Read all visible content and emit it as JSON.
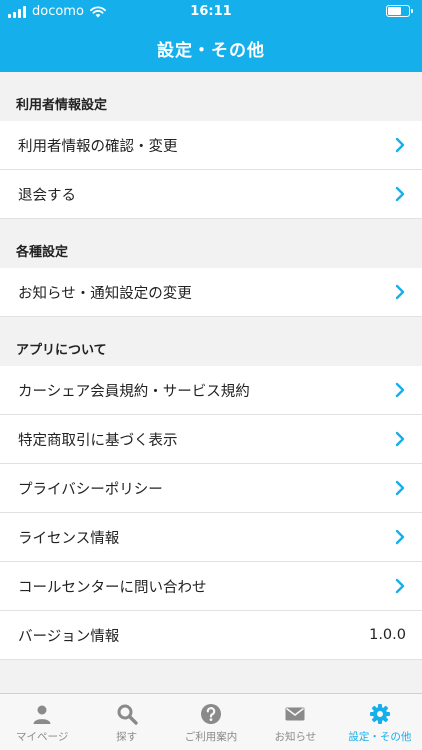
{
  "status_bar": {
    "carrier": "docomo",
    "time": "16:11",
    "battery_level": 0.7
  },
  "header": {
    "title": "設定・その他"
  },
  "sections": [
    {
      "title": "利用者情報設定",
      "rows": [
        {
          "label": "利用者情報の確認・変更"
        },
        {
          "label": "退会する"
        }
      ]
    },
    {
      "title": "各種設定",
      "rows": [
        {
          "label": "お知らせ・通知設定の変更"
        }
      ]
    },
    {
      "title": "アプリについて",
      "rows": [
        {
          "label": "カーシェア会員規約・サービス規約"
        },
        {
          "label": "特定商取引に基づく表示"
        },
        {
          "label": "プライバシーポリシー"
        },
        {
          "label": "ライセンス情報"
        },
        {
          "label": "コールセンターに問い合わせ"
        },
        {
          "label": "バージョン情報",
          "value": "1.0.0"
        }
      ]
    }
  ],
  "tabbar": {
    "tabs": [
      {
        "label": "マイページ",
        "icon": "person-icon"
      },
      {
        "label": "探す",
        "icon": "search-icon"
      },
      {
        "label": "ご利用案内",
        "icon": "question-circle-icon"
      },
      {
        "label": "お知らせ",
        "icon": "envelope-icon"
      },
      {
        "label": "設定・その他",
        "icon": "gear-icon",
        "active": true
      }
    ]
  },
  "colors": {
    "accent": "#15b0ec",
    "tab_inactive": "#8a8a8a"
  }
}
